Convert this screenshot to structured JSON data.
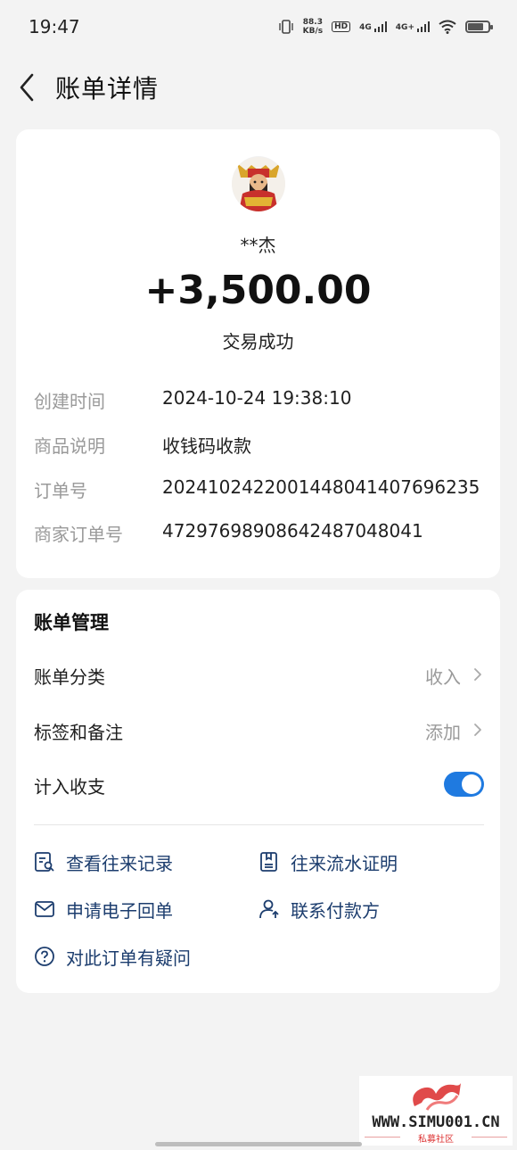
{
  "status_bar": {
    "time": "19:47",
    "net_speed_value": "88.3",
    "net_speed_unit": "KB/s",
    "hd_label": "HD",
    "signal1": "4G",
    "signal2": "4G+"
  },
  "header": {
    "title": "账单详情"
  },
  "transaction": {
    "payer_name": "**杰",
    "amount": "+3,500.00",
    "status": "交易成功",
    "details": [
      {
        "label": "创建时间",
        "value": "2024-10-24 19:38:10"
      },
      {
        "label": "商品说明",
        "value": "收钱码收款"
      },
      {
        "label": "订单号",
        "value": "2024102422001448041407696235"
      },
      {
        "label": "商家订单号",
        "value": "472976989086424870480​41"
      }
    ]
  },
  "management": {
    "title": "账单管理",
    "category_label": "账单分类",
    "category_value": "收入",
    "tags_label": "标签和备注",
    "tags_value": "添加",
    "count_label": "计入收支",
    "count_enabled": true
  },
  "actions": {
    "view_records": "查看往来记录",
    "flow_proof": "往来流水证明",
    "e_receipt": "申请电子回单",
    "contact_payer": "联系付款方",
    "question": "对此订单有疑问"
  },
  "watermark": {
    "site": "WWW.SIMU001.CN",
    "sub": "私募社区"
  },
  "colors": {
    "accent": "#1f7ae0",
    "action_text": "#1c3d6e",
    "background": "#f3f3f3"
  }
}
